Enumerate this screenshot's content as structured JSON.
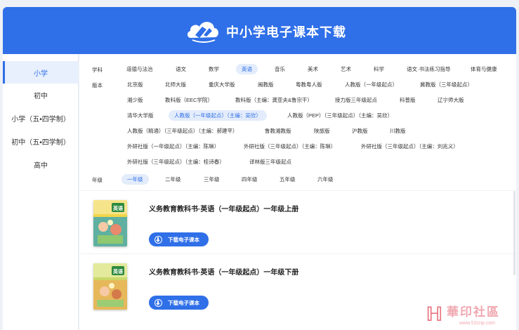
{
  "header": {
    "title": "中小学电子课本下载"
  },
  "sidebar": {
    "items": [
      "小学",
      "初中",
      "小学（五•四学制）",
      "初中（五•四学制）",
      "高中"
    ]
  },
  "filters": {
    "subject_label": "学科",
    "subjects": [
      "道德与法治",
      "语文",
      "数学",
      "英语",
      "音乐",
      "美术",
      "艺术",
      "科学",
      "语文·书法练习指导",
      "体育与健康"
    ],
    "edition_label": "版本",
    "editions": [
      "北京版",
      "北师大版",
      "重庆大学版",
      "闽教版",
      "粤教粤人版",
      "人教版（一年级起点）",
      "冀教版（三年级起点）",
      "湘少版",
      "教科版（EEC学院）",
      "教科版（主编：龚亚夫&鲁宗干）",
      "接力版三年级起点",
      "科普版",
      "辽宁师大版",
      "清华大学版",
      "人教版（一年级起点）（主编：吴欣）",
      "人教版（PEP）（三年级起点）（主编：吴欣）",
      "人教版（精通）（三年级起点）（主编：郝建平）",
      "鲁教湘教版",
      "陕旅版",
      "沪教版",
      "川教版",
      "外研社版（一年级起点）（主编：陈琳）",
      "外研社版（三年级起点）（主编：陈琳）",
      "外研社版（三年级起点）（主编：刘兆义）",
      "外研社版（三年级起点）（主编：桂诗春）",
      "译林版三年级起点"
    ],
    "grade_label": "年级",
    "grades": [
      "一年级",
      "二年级",
      "三年级",
      "四年级",
      "五年级",
      "六年级"
    ]
  },
  "books": [
    {
      "title": "义务教育教科书·英语（一年级起点）一年级上册",
      "cover_text": "英语",
      "button": "下载电子课本"
    },
    {
      "title": "义务教育教科书·英语（一年级起点）一年级下册",
      "cover_text": "英语",
      "button": "下载电子课本"
    }
  ],
  "watermark": {
    "text": "華印社區",
    "url": "www.52cnp.com"
  },
  "colors": {
    "primary": "#2f6fe8",
    "selected_bg": "#e3ecfb",
    "sidebar_active_bg": "#e8f0fd"
  }
}
